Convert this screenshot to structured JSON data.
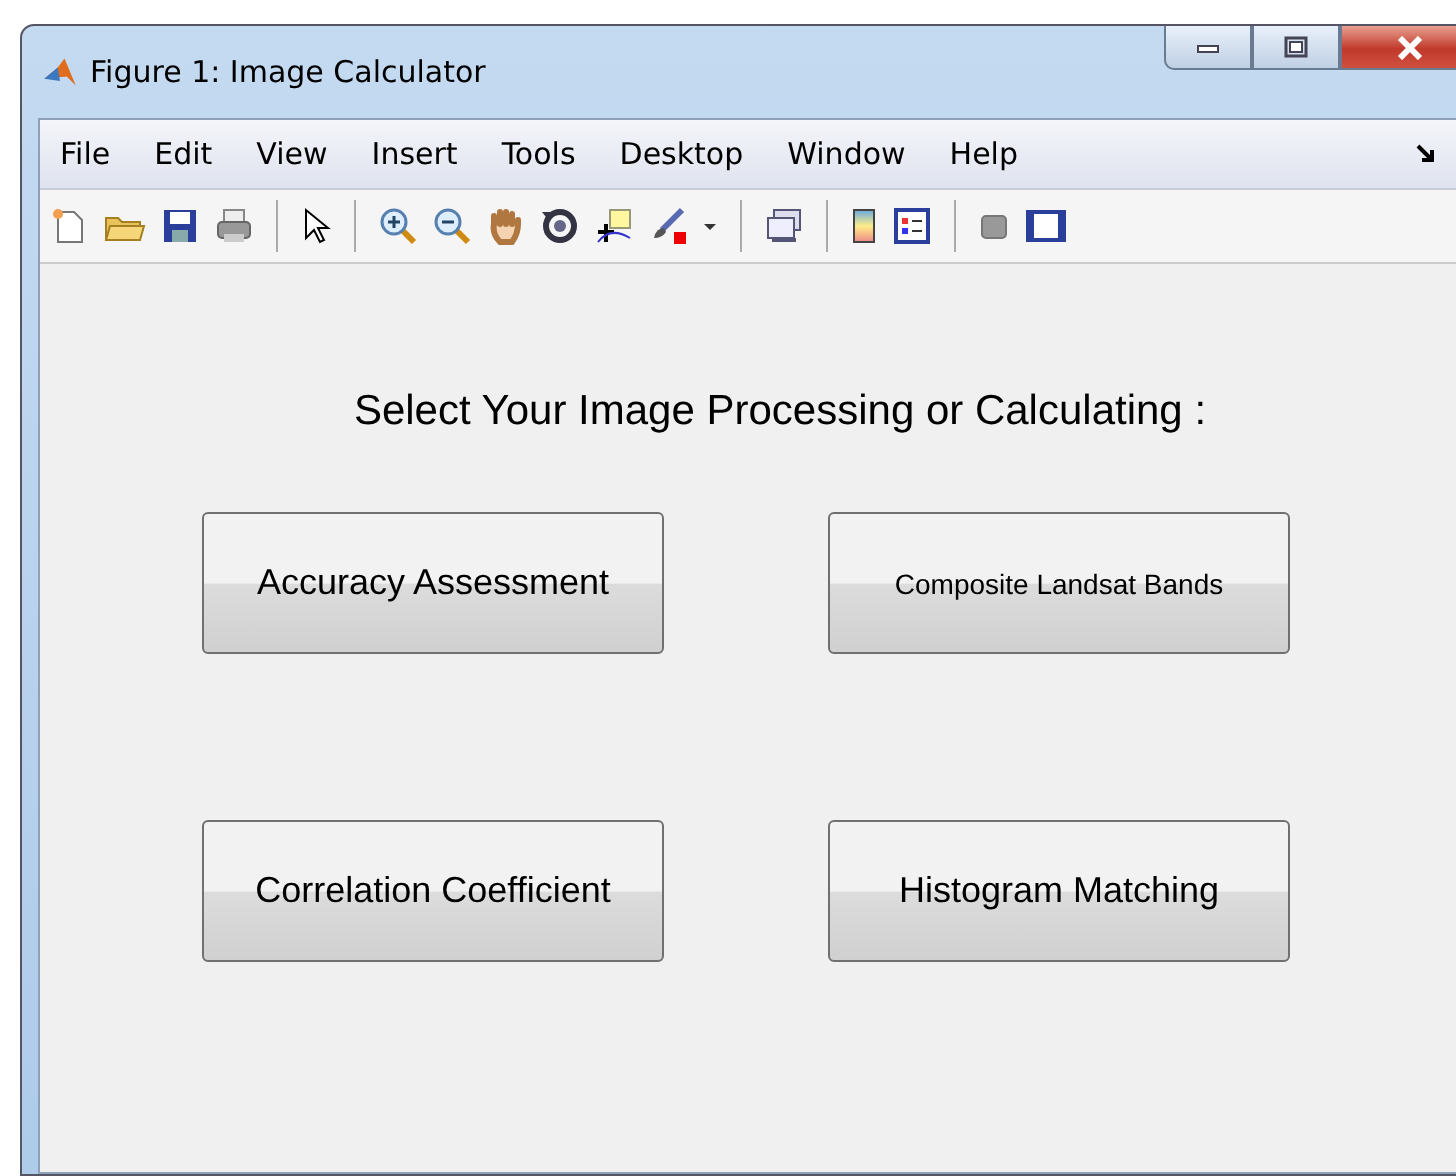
{
  "window": {
    "title": "Figure 1: Image Calculator"
  },
  "menu": [
    "File",
    "Edit",
    "View",
    "Insert",
    "Tools",
    "Desktop",
    "Window",
    "Help"
  ],
  "heading": "Select Your Image Processing or Calculating :",
  "buttons": [
    {
      "label": "Accuracy Assessment"
    },
    {
      "label": "Composite Landsat Bands"
    },
    {
      "label": "Correlation Coefficient"
    },
    {
      "label": "Histogram Matching"
    }
  ]
}
